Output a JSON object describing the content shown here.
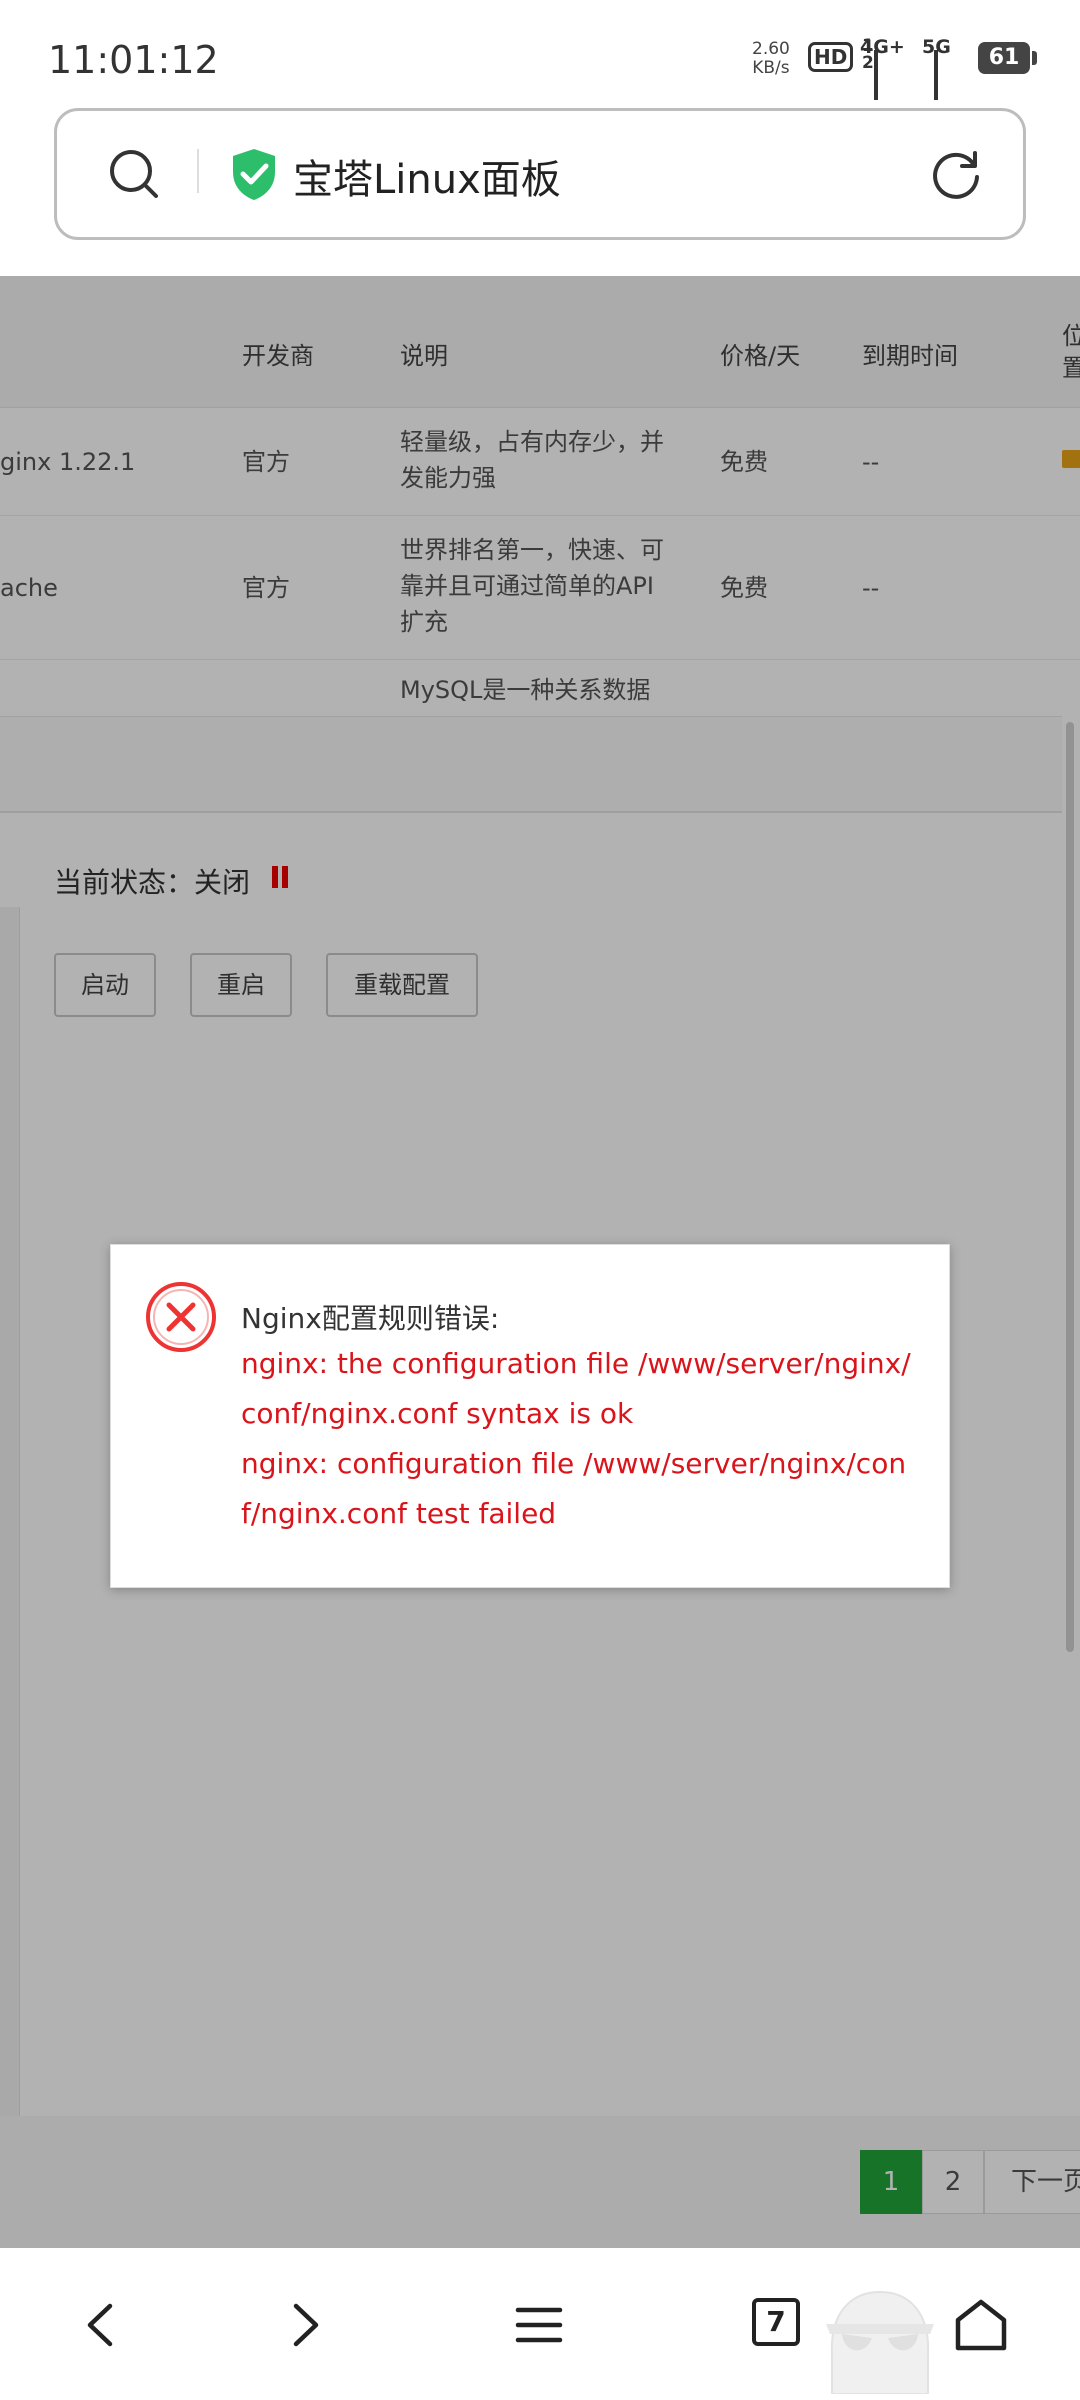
{
  "status_bar": {
    "time": "11:01:12",
    "net_speed_value": "2.60",
    "net_speed_unit": "KB/s",
    "hd_label": "HD",
    "hd_sims": "1 2",
    "net1": "4G+",
    "net2": "5G",
    "battery": "61"
  },
  "address_bar": {
    "title": "宝塔Linux面板",
    "secure_color": "#2dbe6c"
  },
  "table": {
    "headers": [
      "开发商",
      "说明",
      "价格/天",
      "到期时间",
      "位置"
    ],
    "rows": [
      {
        "name": "ginx 1.22.1",
        "vendor": "官方",
        "desc1": "轻量级，占有内存少，并",
        "desc2": "发能力强",
        "desc3": "",
        "price": "免费",
        "expire": "--"
      },
      {
        "name": "ache",
        "vendor": "官方",
        "desc1": "世界排名第一，快速、可",
        "desc2": "靠并且可通过简单的API",
        "desc3": "扩充",
        "price": "免费",
        "expire": "--"
      },
      {
        "name": "",
        "vendor": "",
        "desc1": "MySQL是一种关系数据",
        "desc2": "",
        "desc3": "",
        "price": "",
        "expire": ""
      }
    ]
  },
  "panel": {
    "status_label": "当前状态：关闭",
    "buttons": {
      "start": "启动",
      "restart": "重启",
      "reload": "重载配置"
    }
  },
  "pagination": {
    "p1": "1",
    "p2": "2",
    "next": "下一页"
  },
  "dialog": {
    "title": "Nginx配置规则错误:",
    "lines": [
      "nginx: the configuration file /www/server/nginx/",
      "conf/nginx.conf syntax is ok",
      "nginx: configuration file /www/server/nginx/con",
      "f/nginx.conf test failed"
    ],
    "error_color": "#d9141b"
  },
  "navbar": {
    "tabs_count": "7"
  }
}
